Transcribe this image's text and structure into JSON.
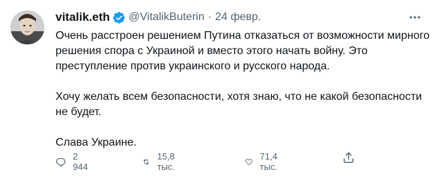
{
  "author": {
    "display_name": "vitalik.eth",
    "handle": "@VitalikButerin",
    "date": "24 февр.",
    "verified": true,
    "avatar_icon": "avatar-photo"
  },
  "tweet": {
    "paragraphs": [
      "Очень расстроен решением Путина отказаться от возможности мирного решения спора с Украиной и вместо этого начать войну. Это преступление против украинского и русского народа.",
      "Хочу желать всем безопасности, хотя знаю, что не какой безопасности не будет.",
      "Слава Украине."
    ]
  },
  "actions": {
    "reply": {
      "icon": "reply-icon",
      "count": "2 944"
    },
    "retweet": {
      "icon": "retweet-icon",
      "count": "15,8 тыс."
    },
    "like": {
      "icon": "heart-icon",
      "count": "71,4 тыс."
    },
    "share": {
      "icon": "share-icon"
    }
  },
  "colors": {
    "text": "#0f1419",
    "secondary": "#536471",
    "verified": "#1d9bf0"
  }
}
